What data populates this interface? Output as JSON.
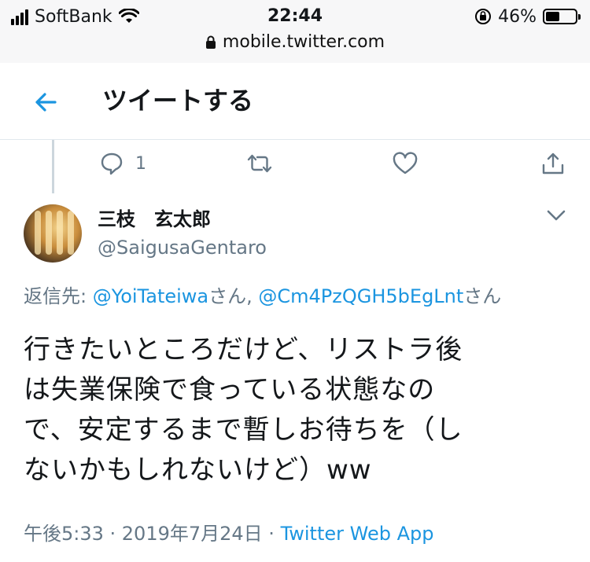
{
  "status_bar": {
    "carrier": "SoftBank",
    "time": "22:44",
    "battery_percent": "46%",
    "battery_level": 0.46,
    "url": "mobile.twitter.com"
  },
  "header": {
    "title": "ツイートする"
  },
  "previous_tweet_actions": {
    "reply_count": "1"
  },
  "tweet": {
    "author_name": "三枝　玄太郎",
    "author_handle": "@SaigusaGentaro",
    "reply_prefix": "返信先: ",
    "reply_to": [
      {
        "mention": "@YoiTateiwa",
        "suffix": "さん"
      },
      {
        "mention": "@Cm4PzQGH5bEgLnt",
        "suffix": "さん"
      }
    ],
    "reply_separator": ", ",
    "text_lines": [
      "行きたいところだけど、リストラ後",
      "は失業保険で食っている状態なの",
      "で、安定するまで暫しお待ちを（し",
      "ないかもしれないけど）ww"
    ],
    "timestamp": "午後5:33 · 2019年7月24日 · ",
    "source": "Twitter Web App"
  },
  "colors": {
    "accent": "#1b95e0",
    "secondary_text": "#657786",
    "divider": "#e1e8ed"
  },
  "icons": {
    "back": "arrow-left-icon",
    "reply": "comment-icon",
    "retweet": "retweet-icon",
    "like": "heart-icon",
    "share": "share-icon",
    "caret": "chevron-down-icon"
  }
}
